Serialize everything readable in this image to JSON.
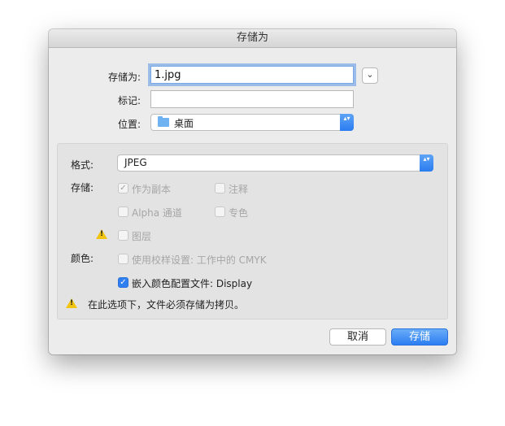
{
  "dialog": {
    "title": "存储为",
    "save_as_label": "存储为:",
    "filename_value": "1.jpg",
    "expand_glyph": "⌄",
    "tags_label": "标记:",
    "tags_value": "",
    "where_label": "位置:",
    "where_value": "桌面",
    "format_label": "格式:",
    "format_value": "JPEG",
    "save_section_label": "存储:",
    "options": {
      "as_copy": "作为副本",
      "notes": "注释",
      "alpha": "Alpha 通道",
      "spot": "专色",
      "layers": "图层"
    },
    "color_section_label": "颜色:",
    "proof_setup": "使用校样设置: 工作中的 CMYK",
    "embed_profile": "嵌入颜色配置文件: Display",
    "warning_text": "在此选项下，文件必须存储为拷贝。",
    "cancel_label": "取消",
    "save_label": "存储"
  },
  "icons": {
    "checkmark": "✓",
    "warning": "!",
    "stepper": "▴▾",
    "folder": "folder-icon"
  },
  "colors": {
    "accent": "#2b7ef1",
    "warning": "#f1c40f",
    "folder": "#6fb2f2"
  }
}
